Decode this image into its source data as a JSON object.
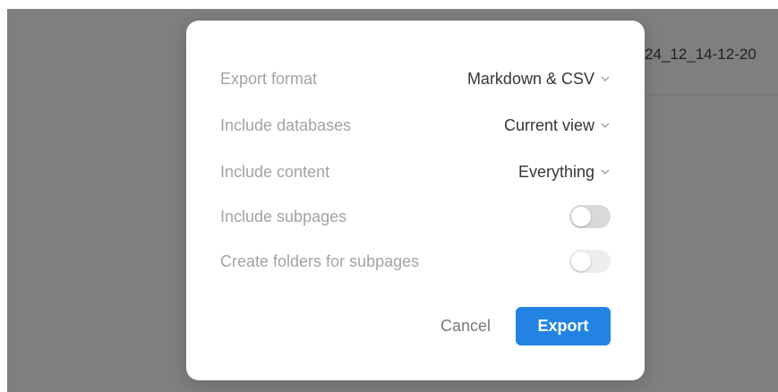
{
  "background": {
    "page_title_fragment": "24_12_14-12-20"
  },
  "dialog": {
    "rows": [
      {
        "label": "Export format",
        "value": "Markdown & CSV"
      },
      {
        "label": "Include databases",
        "value": "Current view"
      },
      {
        "label": "Include content",
        "value": "Everything"
      },
      {
        "label": "Include subpages",
        "toggle": false
      },
      {
        "label": "Create folders for subpages",
        "toggle": false,
        "disabled": true
      }
    ],
    "cancel_label": "Cancel",
    "export_label": "Export",
    "accent_color": "#2383e2"
  },
  "icons": {
    "dropdown": "chevron-down-icon"
  }
}
